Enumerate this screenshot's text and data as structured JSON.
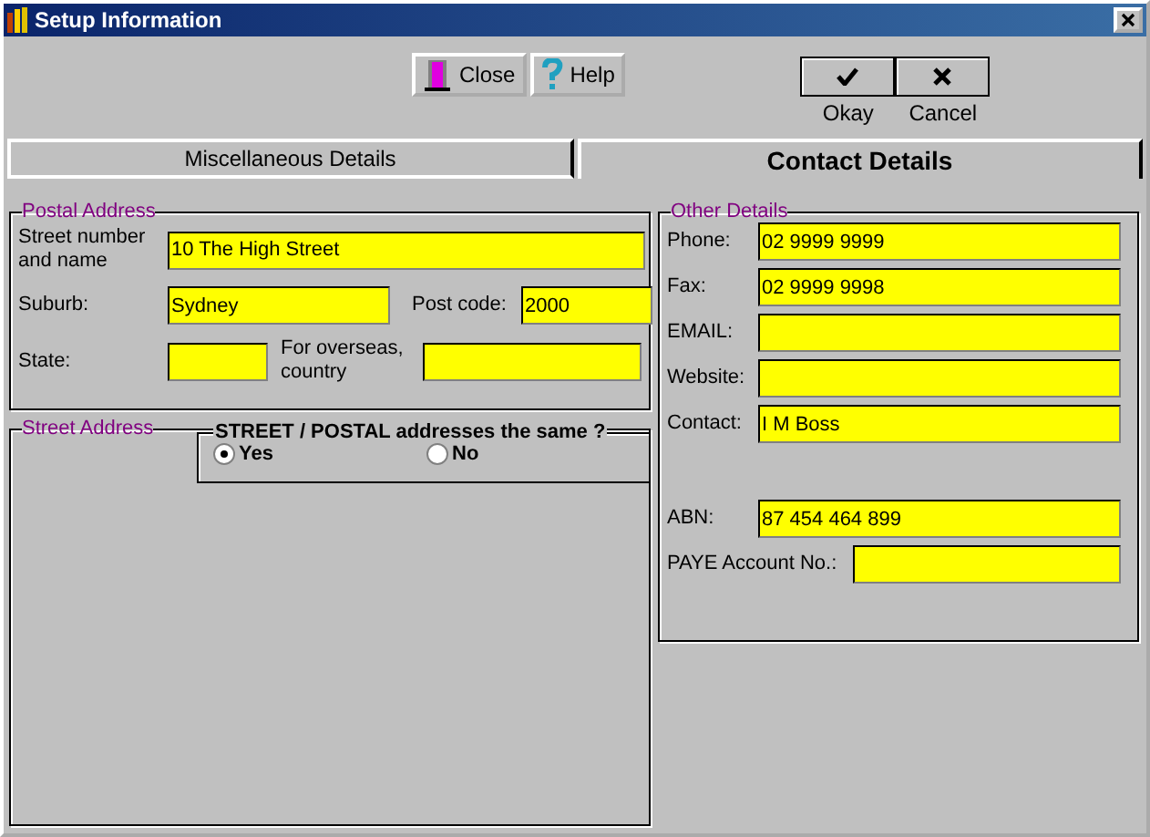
{
  "window": {
    "title": "Setup Information"
  },
  "toolbar": {
    "buttons": [
      {
        "kind": "close",
        "label": "Close"
      },
      {
        "kind": "help",
        "label": "Help"
      }
    ]
  },
  "dialog_buttons": [
    {
      "kind": "okay",
      "label": "Okay"
    },
    {
      "kind": "cancel",
      "label": "Cancel"
    }
  ],
  "tabs": [
    {
      "label": "Miscellaneous Details",
      "selected": false
    },
    {
      "label": "Contact Details",
      "selected": true
    }
  ],
  "postal_address": {
    "title": "Postal Address",
    "street": {
      "label": "Street number and name",
      "value": "10 The High Street"
    },
    "suburb": {
      "label": "Suburb:",
      "value": "Sydney"
    },
    "post_code": {
      "label": "Post code:",
      "value": "2000"
    },
    "state": {
      "label": "State:"
    },
    "country": {
      "label": "For overseas, country"
    }
  },
  "street_address": {
    "title": "Street Address",
    "same_question": {
      "title": "STREET / POSTAL addresses the same ?",
      "options": [
        {
          "label": "Yes",
          "selected": true
        },
        {
          "label": "No",
          "selected": false
        }
      ]
    }
  },
  "other_details": {
    "title": "Other Details",
    "fields": [
      {
        "label": "Phone:",
        "value": "02 9999 9999"
      },
      {
        "label": "Fax:",
        "value": "02 9999 9998"
      },
      {
        "label": "EMAIL:"
      },
      {
        "label": "Website:"
      },
      {
        "label": "Contact:",
        "value": "I M Boss"
      }
    ],
    "abn": {
      "label": "ABN:",
      "value": "87 454 464 899"
    },
    "paye": {
      "label": "PAYE Account No.:"
    }
  }
}
